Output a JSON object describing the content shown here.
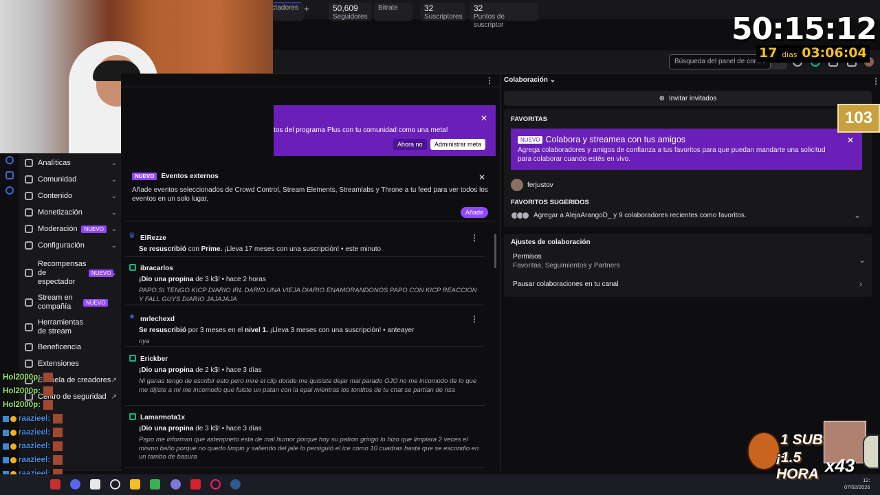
{
  "browser": {
    "new_tab_symbol": "+"
  },
  "overlay": {
    "timer": "50:15:12",
    "timer_days_value": "17",
    "timer_days_label": "dias",
    "timer_clock": "03:06:04",
    "counter_badge": "103",
    "sub_promo_line1": "1 SUB -",
    "sub_promo_line2": "¡1.5 HORA",
    "multiplier": "x43",
    "chat": [
      {
        "user": "Hol2000p",
        "sep": ":"
      },
      {
        "user": "Hol2000p",
        "sep": ":"
      },
      {
        "user": "Hol2000p",
        "sep": ":"
      },
      {
        "user": "raazieel",
        "sep": ":"
      },
      {
        "user": "raazieel",
        "sep": ":"
      },
      {
        "user": "raazieel",
        "sep": ":"
      },
      {
        "user": "raazieel",
        "sep": ":"
      },
      {
        "user": "raazieel",
        "sep": ":"
      },
      {
        "user": "raazieel",
        "sep": ":"
      }
    ]
  },
  "stats": [
    {
      "value": "",
      "label": "ectadores"
    },
    {
      "value": "50,609",
      "label": "Seguidores"
    },
    {
      "value": "",
      "label": "Bitrate"
    },
    {
      "value": "32",
      "label": "Suscriptores"
    },
    {
      "value": "32",
      "label": "Puntos de suscriptor"
    }
  ],
  "search": {
    "placeholder": "Búsqueda del panel de control"
  },
  "sidebar": {
    "new_badge": "NUEVO",
    "items": [
      {
        "label": "Analíticas",
        "chevron": "⌄"
      },
      {
        "label": "Comunidad",
        "chevron": "⌄"
      },
      {
        "label": "Contenido",
        "chevron": "⌄"
      },
      {
        "label": "Monetización",
        "chevron": "⌄"
      },
      {
        "label": "Moderación",
        "chevron": "⌄"
      },
      {
        "label": "Configuración",
        "chevron": "⌄"
      },
      {
        "label": "Recompensas de espectador",
        "chevron": "⌄"
      },
      {
        "label": "Stream en compañía",
        "chevron": ""
      },
      {
        "label": "Herramientas de stream",
        "chevron": ""
      },
      {
        "label": "Beneficencia",
        "chevron": ""
      },
      {
        "label": "Extensiones",
        "chevron": ""
      },
      {
        "label": "Escuela de creadores",
        "chevron": "↗"
      },
      {
        "label": "Centro de seguridad",
        "chevron": "↗"
      }
    ]
  },
  "promo": {
    "text": "tos del programa Plus con tu comunidad como una meta!",
    "later": "Ahora no",
    "manage": "Administrar meta",
    "close": "✕"
  },
  "external_events": {
    "badge": "NUEVO",
    "title": "Eventos externos",
    "description": "Añade eventos seleccionados de Crowd Control, Stream Elements, Streamlabs y Throne a tu feed para ver todos los eventos en un solo lugar.",
    "add": "Añadir",
    "close": "✕"
  },
  "feed": [
    {
      "name": "ElRezze",
      "action": "Se resuscribió",
      "action_rest": " con ",
      "bold2": "Prime.",
      "rest": " ¡Lleva 17 meses con una suscripción! • este minuto",
      "message": ""
    },
    {
      "name": "ibracarlos",
      "action": "¡Dio una propina",
      "action_rest": " de 3 k$! • hace 2 horas",
      "bold2": "",
      "rest": "",
      "message": "PAPO:SI TENGO KICP DIARIO IRL DARIO UNA VIEJA DIARIO ENAMORANDONOS PAPO CON KICP REACCION Y FALL GUYS DIARIO JAJAJAJA"
    },
    {
      "name": "mrlechexd",
      "action": "Se resuscribió",
      "action_rest": " por 3 meses en el ",
      "bold2": "nivel 1.",
      "rest": " ¡Lleva 3 meses con una suscripción! • anteayer",
      "message": "nya"
    },
    {
      "name": "Erickber",
      "action": "¡Dio una propina",
      "action_rest": " de 2 k$! • hace 3 días",
      "bold2": "",
      "rest": "",
      "message": "Ni ganas tengo de escribir esto pero mire el clip donde me quisiste dejar mal parado OJO no me incomodo de lo que me dijiste a mi me incomodo que fuiste un patan con la epal mientras los tontitos de tu chat se partían de risa"
    },
    {
      "name": "Lamarmota1x",
      "action": "¡Dio una propina",
      "action_rest": " de 3 k$! • hace 3 días",
      "bold2": "",
      "rest": "",
      "message": "Papo me informan que astenprieto esta de mal humor porque hoy su patron gringo lo hizo que limpiara 2 veces el mismo baño porque no quedo limpio y saliendo del jale lo persiguió el ice como 10 cuadras hasta que se escondio en un tambo de basura"
    }
  ],
  "collab": {
    "header": "Colaboración",
    "invite": "Invitar invitados",
    "favorites_title": "FAVORITAS",
    "banner_badge": "NUEVO",
    "banner_title": "Colabora y streamea con tus amigos",
    "banner_desc": "Agrega colaboradores y amigos de confianza a tus favoritos para que puedan mandarte una solicitud para colaborar cuando estés en vivo.",
    "favorite_user": "ferjustov",
    "suggested_title": "FAVORITOS SUGERIDOS",
    "suggested_text": "Agregar a AlejaArangoD_ y 9 colaboradores recientes como favoritos.",
    "settings_title": "Ajustes de colaboración",
    "permissions_label": "Permisos",
    "permissions_sub": "Favoritas, Seguimientos y Partners",
    "pause_label": "Pausar colaboraciones en tu canal"
  },
  "taskbar": {
    "date": "07/02/2026",
    "time": "12:"
  },
  "colors": {
    "accent": "#9147ff",
    "promo": "#6a1fb8",
    "bg": "#0e0e10",
    "panel": "#18181b",
    "timer_yellow": "#f2c020"
  }
}
